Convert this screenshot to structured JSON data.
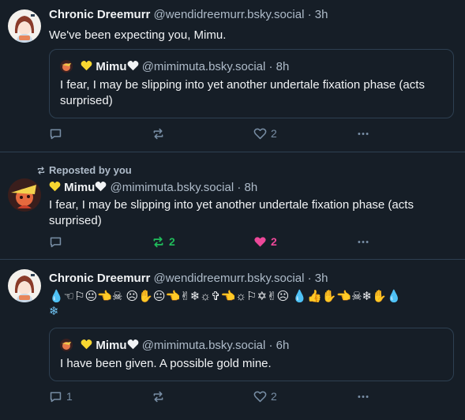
{
  "colors": {
    "background": "#161e27",
    "border": "#2e4052",
    "text": "#f1f3f5",
    "muted": "#788ea5",
    "repost_green": "#20bc5b",
    "like_pink": "#ec4899"
  },
  "posts": [
    {
      "author_name": "Chronic Dreemurr",
      "author_handle": "@wendidreemurr.bsky.social",
      "time": "· 3h",
      "text": "We've been expecting you, Mimu.",
      "quote": {
        "author_name": "Mimu",
        "author_handle": "@mimimuta.bsky.social",
        "time": "· 8h",
        "text": "I fear, I may be slipping into yet another undertale fixation phase (acts surprised)"
      },
      "reply_count": "",
      "repost_count": "",
      "like_count": "2"
    },
    {
      "repost_label": "Reposted by you",
      "author_name": "Mimu",
      "author_handle": "@mimimuta.bsky.social",
      "time": "· 8h",
      "text": "I fear, I may be slipping into yet another undertale fixation phase (acts surprised)",
      "reply_count": "",
      "repost_count": "2",
      "like_count": "2"
    },
    {
      "author_name": "Chronic Dreemurr",
      "author_handle": "@wendidreemurr.bsky.social",
      "time": "· 3h",
      "text_line1": "💧☜⚐😐👈☠ ☹✋😐👈✌❄☼✞👈☼⚐✡✌☹ 💧👍✋👈☠❄✋💧",
      "text_line2": "❄",
      "quote": {
        "author_name": "Mimu",
        "author_handle": "@mimimuta.bsky.social",
        "time": "· 6h",
        "text": "I have been given. A possible gold mine."
      },
      "reply_count": "1",
      "repost_count": "",
      "like_count": "2"
    }
  ]
}
